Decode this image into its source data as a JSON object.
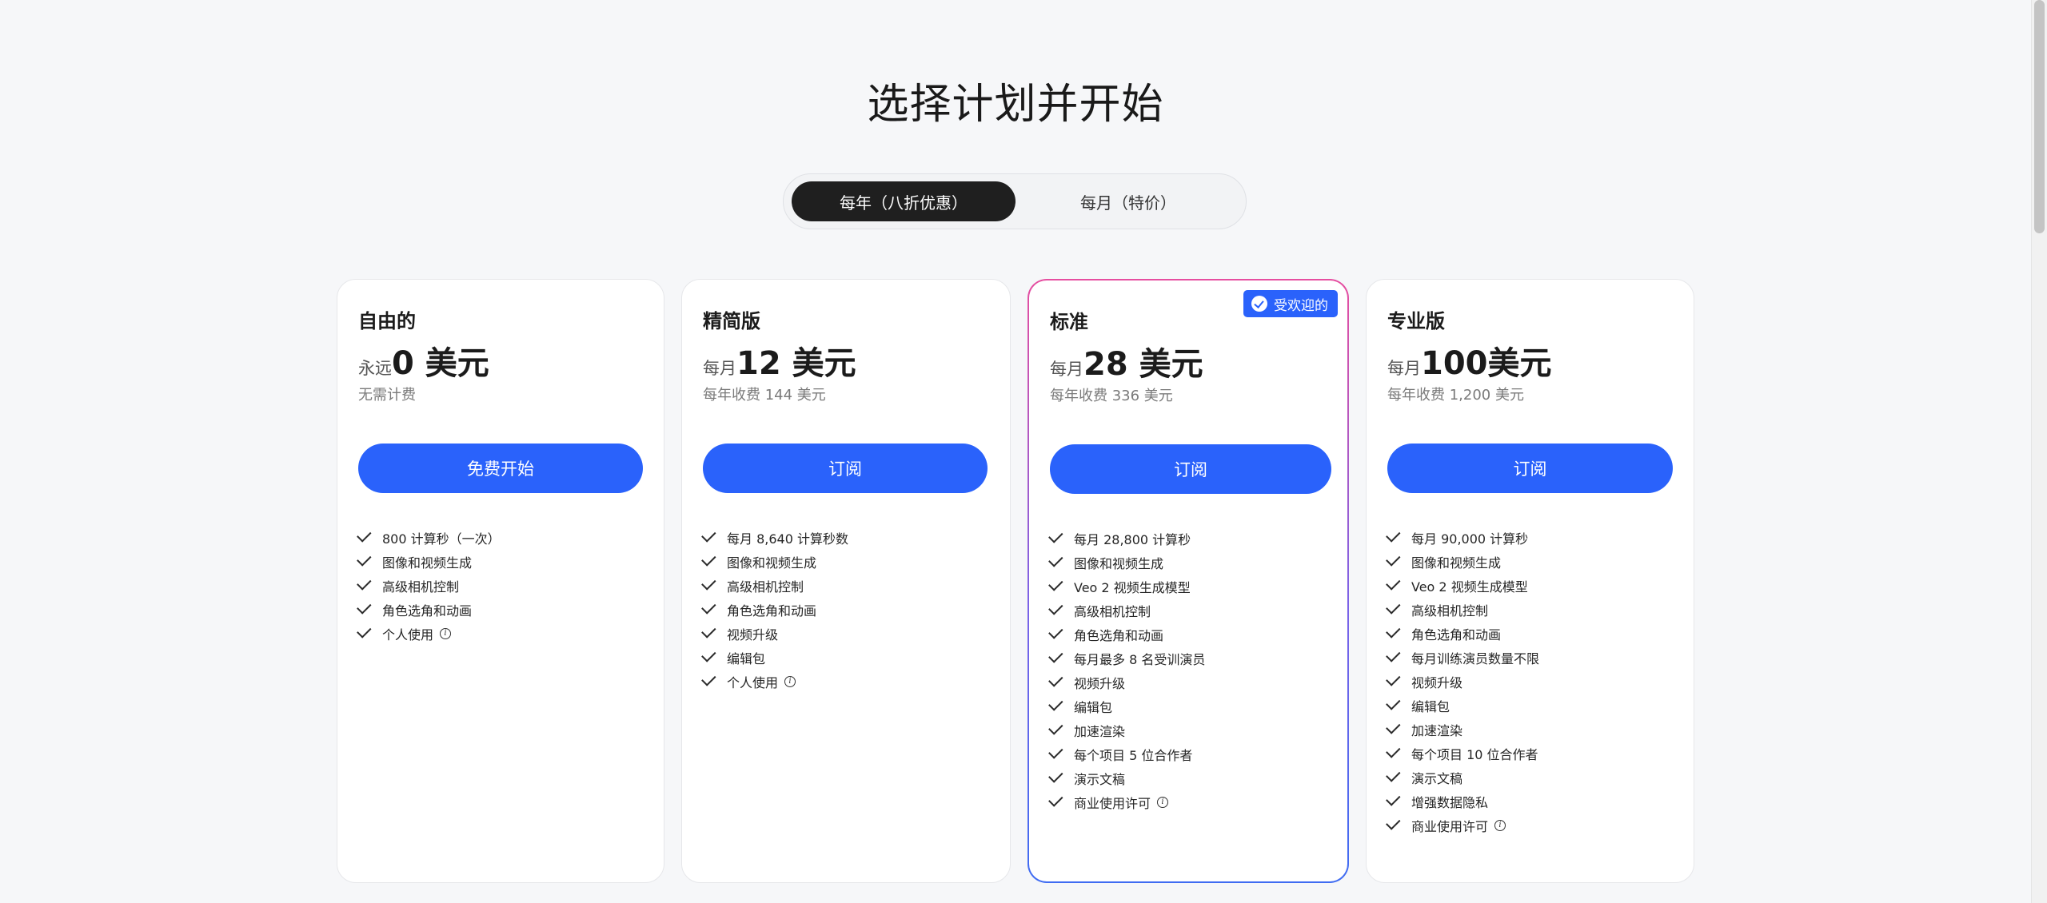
{
  "page": {
    "title": "选择计划并开始"
  },
  "billing_toggle": {
    "yearly_label": "每年（八折优惠）",
    "monthly_label": "每月（特价）",
    "selected": "yearly"
  },
  "plans": [
    {
      "name": "自由的",
      "price_prefix": "永远",
      "price": "0 美元",
      "price_sub": "无需计费",
      "cta": "免费开始",
      "features": [
        {
          "text": "800 计算秒（一次）"
        },
        {
          "text": "图像和视频生成"
        },
        {
          "text": "高级相机控制"
        },
        {
          "text": "角色选角和动画"
        },
        {
          "text": "个人使用",
          "info": "i"
        }
      ]
    },
    {
      "name": "精简版",
      "price_prefix": "每月",
      "price": "12 美元",
      "price_sub": "每年收费 144 美元",
      "cta": "订阅",
      "features": [
        {
          "text": "每月 8,640 计算秒数"
        },
        {
          "text": "图像和视频生成"
        },
        {
          "text": "高级相机控制"
        },
        {
          "text": "角色选角和动画"
        },
        {
          "text": "视频升级"
        },
        {
          "text": "编辑包"
        },
        {
          "text": "个人使用",
          "info": "i"
        }
      ]
    },
    {
      "name": "标准",
      "price_prefix": "每月",
      "price": "28 美元",
      "price_sub": "每年收费 336 美元",
      "cta": "订阅",
      "badge": "受欢迎的",
      "features": [
        {
          "text": "每月 28,800 计算秒"
        },
        {
          "text": "图像和视频生成"
        },
        {
          "text": "Veo 2 视频生成模型"
        },
        {
          "text": "高级相机控制"
        },
        {
          "text": "角色选角和动画"
        },
        {
          "text": "每月最多 8 名受训演员"
        },
        {
          "text": "视频升级"
        },
        {
          "text": "编辑包"
        },
        {
          "text": "加速渲染"
        },
        {
          "text": "每个项目 5 位合作者"
        },
        {
          "text": "演示文稿"
        },
        {
          "text": "商业使用许可",
          "info": "i"
        }
      ]
    },
    {
      "name": "专业版",
      "price_prefix": "每月",
      "price": "100美元",
      "price_sub": "每年收费 1,200 美元",
      "cta": "订阅",
      "features": [
        {
          "text": "每月 90,000 计算秒"
        },
        {
          "text": "图像和视频生成"
        },
        {
          "text": "Veo 2 视频生成模型"
        },
        {
          "text": "高级相机控制"
        },
        {
          "text": "角色选角和动画"
        },
        {
          "text": "每月训练演员数量不限"
        },
        {
          "text": "视频升级"
        },
        {
          "text": "编辑包"
        },
        {
          "text": "加速渲染"
        },
        {
          "text": "每个项目 10 位合作者"
        },
        {
          "text": "演示文稿"
        },
        {
          "text": "增强数据隐私"
        },
        {
          "text": "商业使用许可",
          "info": "i"
        }
      ]
    }
  ],
  "colors": {
    "accent": "#2a62fb",
    "toggle_active_bg": "#1f1f1f",
    "featured_border_top": "#e64ea0",
    "featured_border_bottom": "#3f6cf2"
  }
}
